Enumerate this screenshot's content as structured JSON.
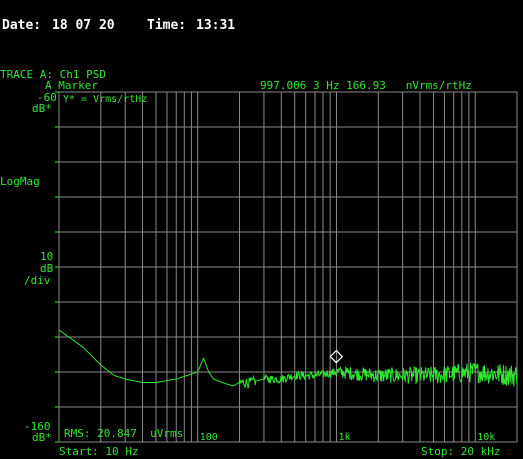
{
  "header": {
    "date_label": "Date:",
    "date_value": "18 07 20",
    "time_label": "Time:",
    "time_value": "13:31"
  },
  "trace": {
    "name": "TRACE A: Ch1 PSD",
    "marker_label": "A Marker",
    "marker_readout": "997.006 3 Hz 166.93   nVrms/rtHz",
    "y_units": "Y* = Vrms/rtHz"
  },
  "axis_left": {
    "top_value": "-60",
    "top_unit": "dB*",
    "scale_type": "LogMag",
    "div_value": "10",
    "div_unit1": "dB",
    "div_unit2": "/div",
    "bottom_value": "-160",
    "bottom_unit": "dB*"
  },
  "footer": {
    "rms_readout": "RMS: 20.847  uVrms",
    "start": "Start: 10 Hz",
    "stop": "Stop: 20 kHz"
  },
  "colors": {
    "background": "#000000",
    "trace": "#2fe62f",
    "grid": "#8a8a8a",
    "text_white": "#ffffff"
  },
  "chart_data": {
    "type": "line",
    "x_scale": "log",
    "xlim": [
      10,
      20000
    ],
    "ylim": [
      -160,
      -60
    ],
    "y_unit": "dB",
    "tick_labels": [
      "100",
      "1k",
      "10k"
    ],
    "marker": {
      "x": 997.006,
      "y": -135.6
    },
    "series": [
      {
        "x": [
          10,
          15,
          20,
          25,
          30,
          40,
          50,
          70,
          100,
          110,
          120,
          130,
          150,
          180,
          200,
          240,
          300,
          400,
          500,
          700,
          1000,
          2000,
          5000,
          10000,
          20000
        ],
        "y": [
          -128,
          -133,
          -138,
          -141,
          -142,
          -143,
          -143,
          -142,
          -140,
          -136,
          -140,
          -142,
          -143,
          -144,
          -143,
          -143,
          -142,
          -142,
          -141,
          -141,
          -140,
          -141,
          -141,
          -140,
          -141
        ]
      }
    ]
  }
}
